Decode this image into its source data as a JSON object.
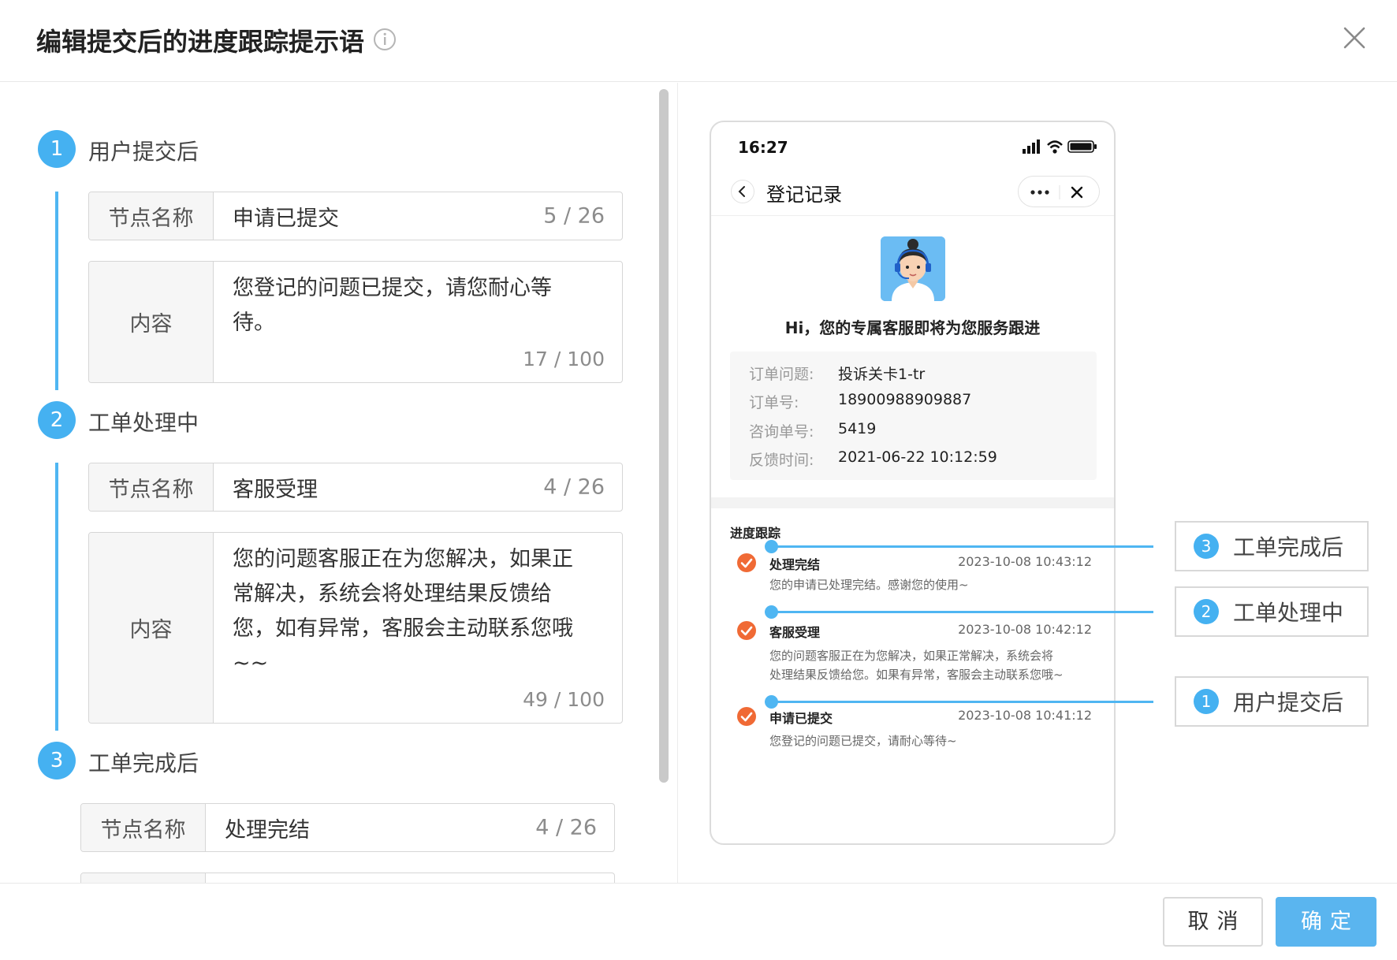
{
  "dialog": {
    "title": "编辑提交后的进度跟踪提示语",
    "cancel_label": "取消",
    "confirm_label": "确定"
  },
  "steps": [
    {
      "number": "1",
      "label": "用户提交后",
      "node_label": "节点名称",
      "node_value": "申请已提交",
      "node_count": "5 / 26",
      "content_label": "内容",
      "content_lines": [
        "您登记的问题已提交，请您耐心等",
        "待。"
      ],
      "content_count": "17 / 100"
    },
    {
      "number": "2",
      "label": "工单处理中",
      "node_label": "节点名称",
      "node_value": "客服受理",
      "node_count": "4 / 26",
      "content_label": "内容",
      "content_lines": [
        "您的问题客服正在为您解决，如果正",
        "常解决，系统会将处理结果反馈给",
        "您，如有异常，客服会主动联系您哦",
        "~~"
      ],
      "content_count": "49 / 100"
    },
    {
      "number": "3",
      "label": "工单完成后",
      "node_label": "节点名称",
      "node_value": "处理完结",
      "node_count": "4 / 26"
    }
  ],
  "phone": {
    "time": "16:27",
    "nav_title": "登记记录",
    "greeting": "Hi，您的专属客服即将为您服务跟进",
    "info": [
      {
        "key": "订单问题:",
        "value": "投诉关卡1-tr"
      },
      {
        "key": "订单号:",
        "value": "18900988909887"
      },
      {
        "key": "咨询单号:",
        "value": "5419"
      },
      {
        "key": "反馈时间:",
        "value": "2021-06-22  10:12:59"
      }
    ],
    "track_title": "进度跟踪",
    "track_items": [
      {
        "title": "处理完结",
        "time": "2023-10-08  10:43:12",
        "desc": [
          "您的申请已处理完结。感谢您的使用~"
        ]
      },
      {
        "title": "客服受理",
        "time": "2023-10-08  10:42:12",
        "desc": [
          "您的问题客服正在为您解决，如果正常解决，系统会将",
          "处理结果反馈给您。如果有异常，客服会主动联系您哦~"
        ]
      },
      {
        "title": "申请已提交",
        "time": "2023-10-08  10:41:12",
        "desc": [
          "您登记的问题已提交，请耐心等待~"
        ]
      }
    ]
  },
  "callouts": [
    {
      "number": "3",
      "label": "工单完成后"
    },
    {
      "number": "2",
      "label": "工单处理中"
    },
    {
      "number": "1",
      "label": "用户提交后"
    }
  ],
  "colors": {
    "accent": "#45b1f1",
    "check": "#f06a35",
    "primary_button": "#5ab5ef"
  },
  "icons": [
    "info-icon",
    "close-icon",
    "back-chevron-icon",
    "more-dots-icon",
    "signal-icon",
    "wifi-icon",
    "battery-icon",
    "check-circle-icon"
  ]
}
